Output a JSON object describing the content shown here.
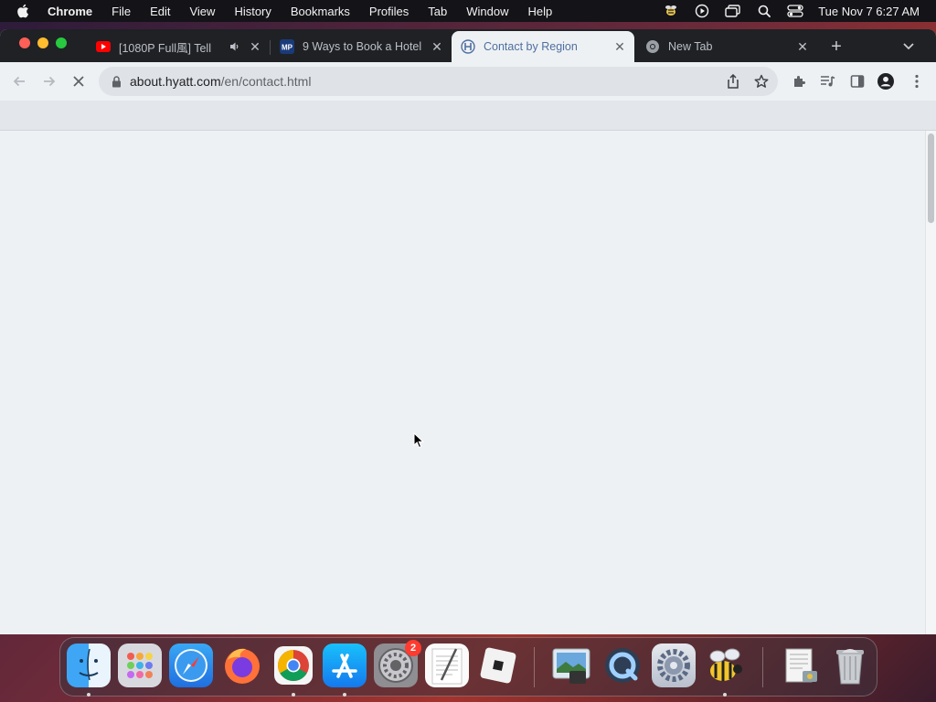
{
  "menubar": {
    "app_name": "Chrome",
    "items": [
      "File",
      "Edit",
      "View",
      "History",
      "Bookmarks",
      "Profiles",
      "Tab",
      "Window",
      "Help"
    ],
    "clock": "Tue Nov 7  6:27 AM"
  },
  "tabs": [
    {
      "title": "[1080P Full風] Tell",
      "favicon": "youtube-icon",
      "audio": true,
      "active": false
    },
    {
      "title": "9 Ways to Book a Hotel",
      "favicon": "mp-icon",
      "favicon_text": "MP",
      "active": false
    },
    {
      "title": "Contact by Region",
      "favicon": "hyatt-icon",
      "active": true
    },
    {
      "title": "New Tab",
      "favicon": "chrome-icon",
      "active": false
    }
  ],
  "toolbar": {
    "url_host": "about.hyatt.com",
    "url_path": "/en/contact.html"
  },
  "dock": {
    "apps": [
      {
        "name": "Finder",
        "icon": "finder-icon",
        "running": true
      },
      {
        "name": "Launchpad",
        "icon": "launchpad-icon",
        "running": false
      },
      {
        "name": "Safari",
        "icon": "safari-icon",
        "running": false
      },
      {
        "name": "Firefox",
        "icon": "firefox-icon",
        "running": false
      },
      {
        "name": "Chrome",
        "icon": "chrome-icon",
        "running": true
      },
      {
        "name": "App Store",
        "icon": "app-store-icon",
        "running": true
      },
      {
        "name": "System Preferences",
        "icon": "system-preferences-icon",
        "running": false,
        "badge": "2"
      },
      {
        "name": "TextEdit",
        "icon": "textedit-icon",
        "running": false
      },
      {
        "name": "Roblox",
        "icon": "roblox-icon",
        "running": false
      },
      {
        "name": "Preview",
        "icon": "preview-icon",
        "running": false
      },
      {
        "name": "QuickTime",
        "icon": "quicktime-icon",
        "running": false
      },
      {
        "name": "Settings",
        "icon": "gear-icon",
        "running": false
      },
      {
        "name": "Bee App",
        "icon": "bee-icon",
        "running": true
      },
      {
        "name": "Documents",
        "icon": "documents-icon",
        "running": false
      },
      {
        "name": "Trash",
        "icon": "trash-icon",
        "running": false
      }
    ]
  },
  "colors": {
    "menubar_bg": "#141318",
    "tabstrip_bg": "#1f2125",
    "toolbar_bg": "#eef1f4",
    "omnibox_bg": "#dfe3e8",
    "active_tab_text": "#4f6fa0"
  }
}
